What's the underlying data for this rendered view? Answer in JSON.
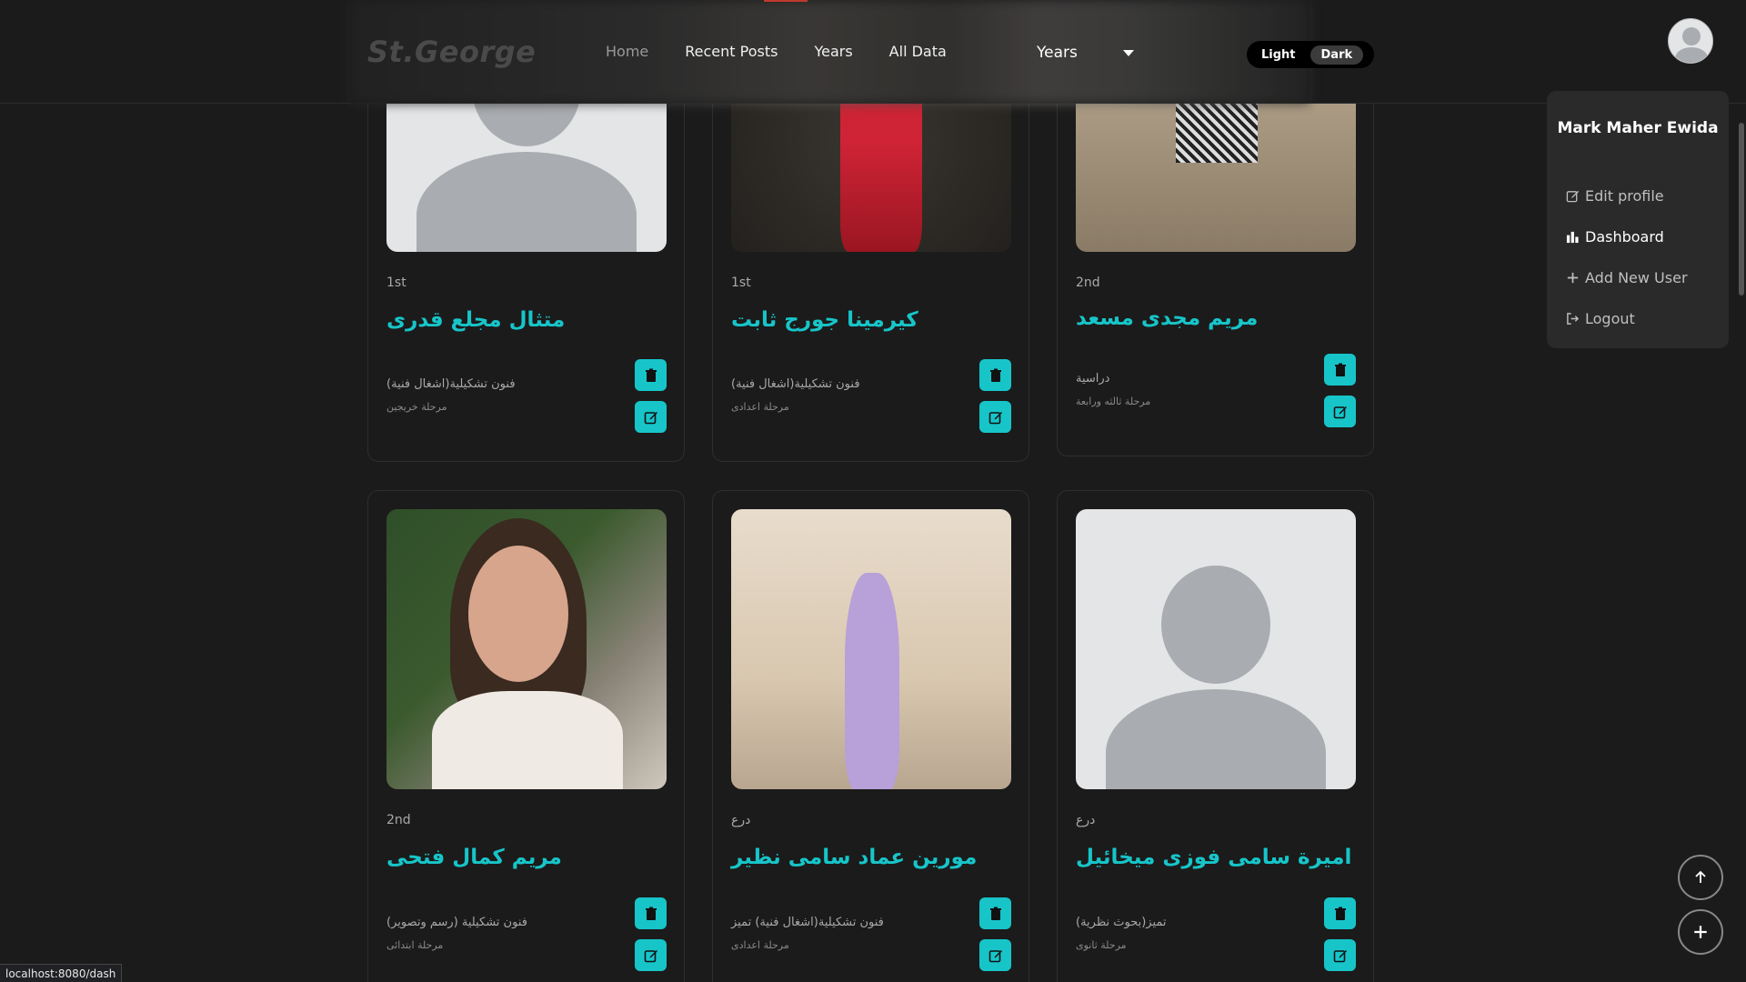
{
  "navbar": {
    "brand": "St.George",
    "links": [
      "Home",
      "Recent Posts",
      "Years",
      "All Data"
    ],
    "years_select": "Years",
    "theme": {
      "light": "Light",
      "dark": "Dark",
      "active": "Dark"
    }
  },
  "user_menu": {
    "name": "Mark Maher Ewida",
    "items": [
      {
        "label": "Edit profile",
        "icon": "edit-icon"
      },
      {
        "label": "Dashboard",
        "icon": "chart-bar-icon"
      },
      {
        "label": "Add New User",
        "icon": "plus-icon"
      },
      {
        "label": "Logout",
        "icon": "logout-icon"
      }
    ]
  },
  "cards": [
    {
      "year": "1st",
      "name": "متثال مجلع قدرى",
      "dept": "فنون تشكيلية(اشغال فنية)",
      "stage": "مرحلة خريجين",
      "photo": "placeholder"
    },
    {
      "year": "1st",
      "name": "كيرمينا جورج ثابت",
      "dept": "فنون تشكيلية(اشغال فنية)",
      "stage": "مرحلة اعدادى",
      "photo": "red-dress"
    },
    {
      "year": "2nd",
      "name": "مريم مجدى مسعد",
      "dept": "دراسية",
      "stage": "مرحلة ثالثه ورابعة",
      "photo": "plaid-skirt"
    },
    {
      "year": "2nd",
      "name": "مريم كمال فتحى",
      "dept": "فنون تشكيلية (رسم وتصوير)",
      "stage": "مرحلة ابتدائى",
      "photo": "portrait"
    },
    {
      "year": "درع",
      "name": "مورين عماد سامى نظير",
      "dept": "فنون تشكيلية(اشغال فنية) تميز",
      "stage": "مرحلة اعدادى",
      "photo": "lilac-dress"
    },
    {
      "year": "درع",
      "name": "اميرة سامى فوزى ميخائيل",
      "dept": "تميز(بحوث نظرية)",
      "stage": "مرحلة ثانوى",
      "photo": "placeholder"
    }
  ],
  "status_url": "localhost:8080/dash",
  "colors": {
    "accent": "#17c5c9",
    "background": "#1b1b1b"
  }
}
